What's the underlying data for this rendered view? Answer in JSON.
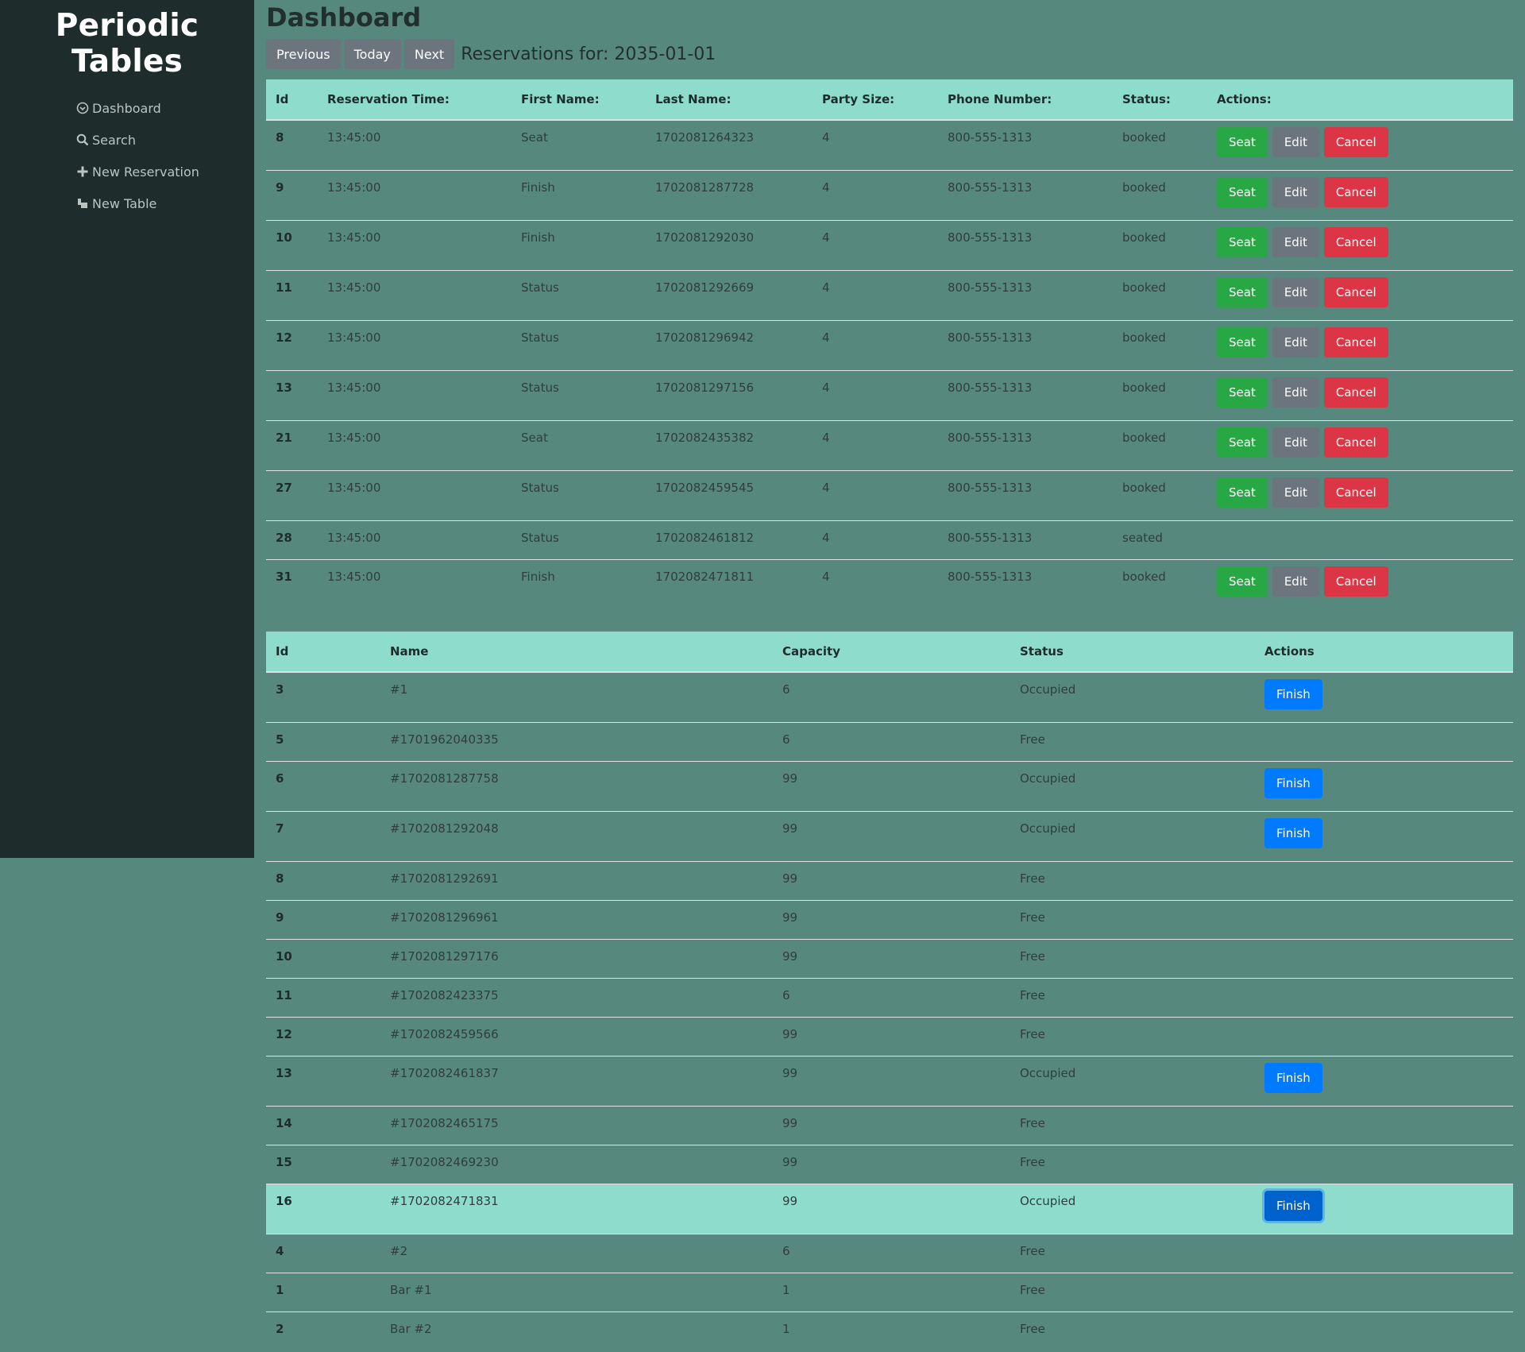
{
  "sidebar": {
    "brand": "Periodic Tables",
    "items": [
      {
        "label": "Dashboard",
        "icon": "dashboard-icon"
      },
      {
        "label": "Search",
        "icon": "search-icon"
      },
      {
        "label": "New Reservation",
        "icon": "plus-icon"
      },
      {
        "label": "New Table",
        "icon": "table-icon"
      }
    ]
  },
  "header": {
    "title": "Dashboard",
    "previous_label": "Previous",
    "today_label": "Today",
    "next_label": "Next",
    "date_heading": "Reservations for: 2035-01-01"
  },
  "reservations": {
    "columns": [
      "Id",
      "Reservation Time:",
      "First Name:",
      "Last Name:",
      "Party Size:",
      "Phone Number:",
      "Status:",
      "Actions:"
    ],
    "seat_label": "Seat",
    "edit_label": "Edit",
    "cancel_label": "Cancel",
    "rows": [
      {
        "id": "8",
        "time": "13:45:00",
        "first": "Seat",
        "last": "1702081264323",
        "party": "4",
        "phone": "800-555-1313",
        "status": "booked"
      },
      {
        "id": "9",
        "time": "13:45:00",
        "first": "Finish",
        "last": "1702081287728",
        "party": "4",
        "phone": "800-555-1313",
        "status": "booked"
      },
      {
        "id": "10",
        "time": "13:45:00",
        "first": "Finish",
        "last": "1702081292030",
        "party": "4",
        "phone": "800-555-1313",
        "status": "booked"
      },
      {
        "id": "11",
        "time": "13:45:00",
        "first": "Status",
        "last": "1702081292669",
        "party": "4",
        "phone": "800-555-1313",
        "status": "booked"
      },
      {
        "id": "12",
        "time": "13:45:00",
        "first": "Status",
        "last": "1702081296942",
        "party": "4",
        "phone": "800-555-1313",
        "status": "booked"
      },
      {
        "id": "13",
        "time": "13:45:00",
        "first": "Status",
        "last": "1702081297156",
        "party": "4",
        "phone": "800-555-1313",
        "status": "booked"
      },
      {
        "id": "21",
        "time": "13:45:00",
        "first": "Seat",
        "last": "1702082435382",
        "party": "4",
        "phone": "800-555-1313",
        "status": "booked"
      },
      {
        "id": "27",
        "time": "13:45:00",
        "first": "Status",
        "last": "1702082459545",
        "party": "4",
        "phone": "800-555-1313",
        "status": "booked"
      },
      {
        "id": "28",
        "time": "13:45:00",
        "first": "Status",
        "last": "1702082461812",
        "party": "4",
        "phone": "800-555-1313",
        "status": "seated"
      },
      {
        "id": "31",
        "time": "13:45:00",
        "first": "Finish",
        "last": "1702082471811",
        "party": "4",
        "phone": "800-555-1313",
        "status": "booked"
      }
    ]
  },
  "tables": {
    "columns": [
      "Id",
      "Name",
      "Capacity",
      "Status",
      "Actions"
    ],
    "finish_label": "Finish",
    "rows": [
      {
        "id": "3",
        "name": "#1",
        "capacity": "6",
        "status": "Occupied"
      },
      {
        "id": "5",
        "name": "#1701962040335",
        "capacity": "6",
        "status": "Free"
      },
      {
        "id": "6",
        "name": "#1702081287758",
        "capacity": "99",
        "status": "Occupied"
      },
      {
        "id": "7",
        "name": "#1702081292048",
        "capacity": "99",
        "status": "Occupied"
      },
      {
        "id": "8",
        "name": "#1702081292691",
        "capacity": "99",
        "status": "Free"
      },
      {
        "id": "9",
        "name": "#1702081296961",
        "capacity": "99",
        "status": "Free"
      },
      {
        "id": "10",
        "name": "#1702081297176",
        "capacity": "99",
        "status": "Free"
      },
      {
        "id": "11",
        "name": "#1702082423375",
        "capacity": "6",
        "status": "Free"
      },
      {
        "id": "12",
        "name": "#1702082459566",
        "capacity": "99",
        "status": "Free"
      },
      {
        "id": "13",
        "name": "#1702082461837",
        "capacity": "99",
        "status": "Occupied"
      },
      {
        "id": "14",
        "name": "#1702082465175",
        "capacity": "99",
        "status": "Free"
      },
      {
        "id": "15",
        "name": "#1702082469230",
        "capacity": "99",
        "status": "Free"
      },
      {
        "id": "16",
        "name": "#1702082471831",
        "capacity": "99",
        "status": "Occupied",
        "highlighted": true
      },
      {
        "id": "4",
        "name": "#2",
        "capacity": "6",
        "status": "Free"
      },
      {
        "id": "1",
        "name": "Bar #1",
        "capacity": "1",
        "status": "Free"
      },
      {
        "id": "2",
        "name": "Bar #2",
        "capacity": "1",
        "status": "Free"
      }
    ]
  },
  "colors": {
    "sidebar_bg": "#1e2d2b",
    "page_bg": "#57887e",
    "header_row": "#8edccc",
    "seat": "#28a745",
    "edit": "#6c757d",
    "cancel": "#dc3545",
    "finish": "#007bff"
  }
}
